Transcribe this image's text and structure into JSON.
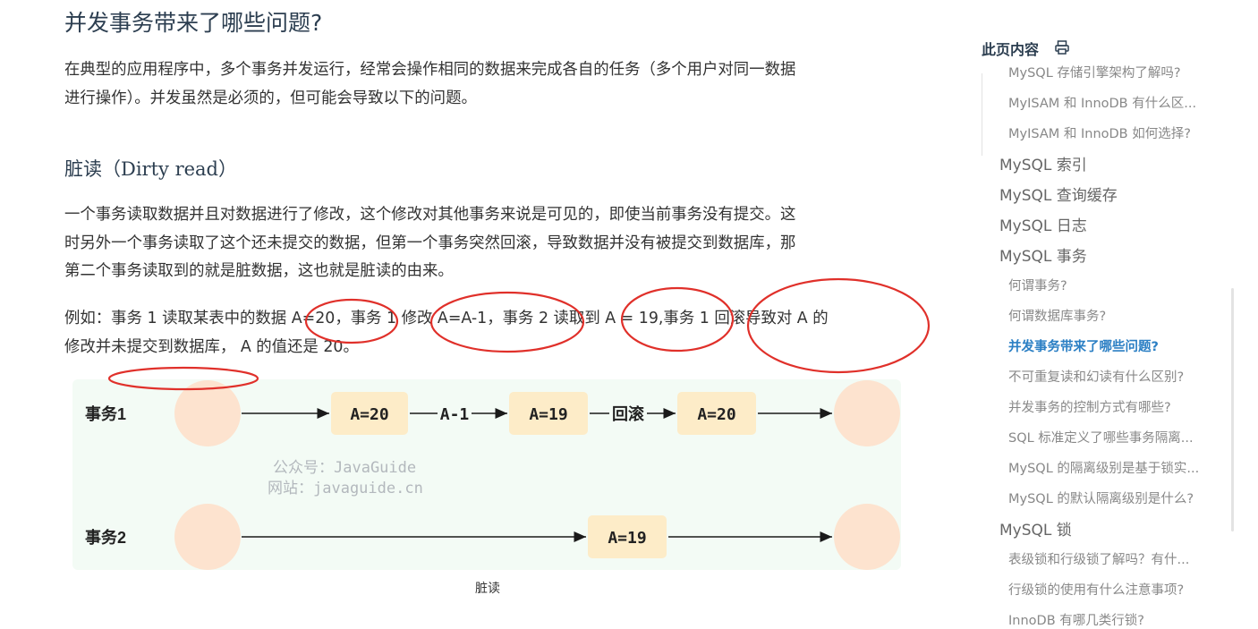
{
  "article": {
    "heading": "并发事务带来了哪些问题?",
    "intro_lines": [
      "在典型的应用程序中，多个事务并发运行，经常会操作相同的数据来完成各自的任务（多个用户对同一数据",
      "进行操作）。并发虽然是必须的，但可能会导致以下的问题。"
    ],
    "section_title": "脏读（Dirty read）",
    "section_lines": [
      "一个事务读取数据并且对数据进行了修改，这个修改对其他事务来说是可见的，即使当前事务没有提交。这",
      "时另外一个事务读取了这个还未提交的数据，但第一个事务突然回滚，导致数据并没有被提交到数据库，那",
      "第二个事务读取到的就是脏数据，这也就是脏读的由来。"
    ],
    "example_lines": [
      "例如：事务 1 读取某表中的数据 A=20，事务 1 修改 A=A-1，事务 2 读取到 A = 19,事务 1 回滚导致对 A 的",
      "修改并未提交到数据库， A 的值还是 20。"
    ],
    "caption": "脏读"
  },
  "diagram": {
    "row1_label": "事务1",
    "row2_label": "事务2",
    "box1": "A=20",
    "edge1": "A-1",
    "box2": "A=19",
    "edge2": "回滚",
    "box3": "A=20",
    "box4": "A=19",
    "watermark_line1": "公众号：JavaGuide",
    "watermark_line2": "网站：javaguide.cn"
  },
  "sidebar": {
    "title": "此页内容",
    "items": [
      {
        "label": "MySQL 存储引擎架构了解吗?",
        "level": 3,
        "active": false
      },
      {
        "label": "MyISAM 和 InnoDB 有什么区...",
        "level": 3,
        "active": false
      },
      {
        "label": "MyISAM 和 InnoDB 如何选择?",
        "level": 3,
        "active": false
      },
      {
        "label": "MySQL 索引",
        "level": 2,
        "active": false
      },
      {
        "label": "MySQL 查询缓存",
        "level": 2,
        "active": false
      },
      {
        "label": "MySQL 日志",
        "level": 2,
        "active": false
      },
      {
        "label": "MySQL 事务",
        "level": 2,
        "active": false
      },
      {
        "label": "何谓事务?",
        "level": 3,
        "active": false
      },
      {
        "label": "何谓数据库事务?",
        "level": 3,
        "active": false
      },
      {
        "label": "并发事务带来了哪些问题?",
        "level": 3,
        "active": true
      },
      {
        "label": "不可重复读和幻读有什么区别?",
        "level": 3,
        "active": false
      },
      {
        "label": "并发事务的控制方式有哪些?",
        "level": 3,
        "active": false
      },
      {
        "label": "SQL 标准定义了哪些事务隔离...",
        "level": 3,
        "active": false
      },
      {
        "label": "MySQL 的隔离级别是基于锁实...",
        "level": 3,
        "active": false
      },
      {
        "label": "MySQL 的默认隔离级别是什么?",
        "level": 3,
        "active": false
      },
      {
        "label": "MySQL 锁",
        "level": 2,
        "active": false
      },
      {
        "label": "表级锁和行级锁了解吗？有什...",
        "level": 3,
        "active": false
      },
      {
        "label": "行级锁的使用有什么注意事项?",
        "level": 3,
        "active": false
      },
      {
        "label": "InnoDB 有哪几类行锁?",
        "level": 3,
        "active": false
      }
    ]
  },
  "colors": {
    "accent": "#2b7fc4",
    "annotation_red": "#e0302a",
    "node_peach": "#fde3cf",
    "box_yellow": "#fdecc8",
    "diagram_bg": "#f3fbf5"
  }
}
